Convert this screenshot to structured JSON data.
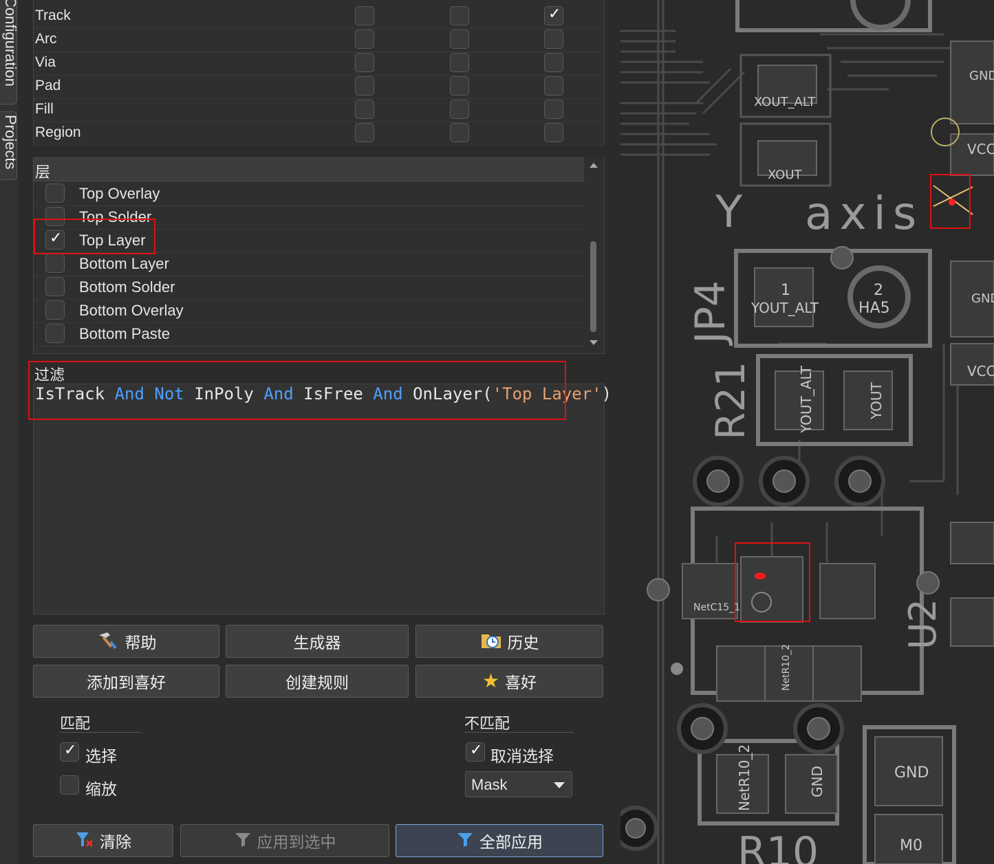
{
  "side_tabs": [
    {
      "label": "Configuration"
    },
    {
      "label": "Projects"
    }
  ],
  "object_types": [
    {
      "label": "Track",
      "col1": false,
      "col2": false,
      "col3": true
    },
    {
      "label": "Arc",
      "col1": false,
      "col2": false,
      "col3": false
    },
    {
      "label": "Via",
      "col1": false,
      "col2": false,
      "col3": false
    },
    {
      "label": "Pad",
      "col1": false,
      "col2": false,
      "col3": false
    },
    {
      "label": "Fill",
      "col1": false,
      "col2": false,
      "col3": false
    },
    {
      "label": "Region",
      "col1": false,
      "col2": false,
      "col3": false
    }
  ],
  "layers": {
    "title": "层",
    "items": [
      {
        "label": "Top Overlay",
        "checked": false
      },
      {
        "label": "Top Solder",
        "checked": false
      },
      {
        "label": "Top Layer",
        "checked": true
      },
      {
        "label": "Bottom Layer",
        "checked": false
      },
      {
        "label": "Bottom Solder",
        "checked": false
      },
      {
        "label": "Bottom Overlay",
        "checked": false
      },
      {
        "label": "Bottom Paste",
        "checked": false
      }
    ]
  },
  "filter": {
    "title": "过滤",
    "expression_tokens": [
      {
        "t": "IsTrack ",
        "k": "id"
      },
      {
        "t": "And ",
        "k": "kw"
      },
      {
        "t": "Not ",
        "k": "kw"
      },
      {
        "t": "InPoly ",
        "k": "id"
      },
      {
        "t": "And ",
        "k": "kw"
      },
      {
        "t": "IsFree ",
        "k": "id"
      },
      {
        "t": "And ",
        "k": "kw"
      },
      {
        "t": "OnLayer(",
        "k": "id"
      },
      {
        "t": "'Top Layer'",
        "k": "str"
      },
      {
        "t": ")",
        "k": "id"
      }
    ]
  },
  "buttons": {
    "help": "帮助",
    "builder": "生成器",
    "history": "历史",
    "add_favorite": "添加到喜好",
    "create_rule": "创建规则",
    "favorites": "喜好",
    "clear": "清除",
    "apply_selected": "应用到选中",
    "apply_all": "全部应用"
  },
  "match": {
    "title": "匹配",
    "select_label": "选择",
    "select_checked": true,
    "zoom_label": "缩放",
    "zoom_checked": false
  },
  "nomatch": {
    "title": "不匹配",
    "deselect_label": "取消选择",
    "deselect_checked": true,
    "mode_value": "Mask"
  },
  "pcb_labels": {
    "jp4": "JP4",
    "r21": "R21",
    "u2": "U2",
    "r10": "R10",
    "y": "Y",
    "axis": "axis",
    "xout_alt": "XOUT_ALT",
    "xout": "XOUT",
    "yout_alt": "YOUT_ALT",
    "ha5": "HA5",
    "yout": "YOUT",
    "gnd": "GND",
    "vcc": "VCC",
    "netc15": "NetC15_1",
    "netr10": "NetR10_2",
    "m0": "M0",
    "n1": "1",
    "n2": "2"
  }
}
